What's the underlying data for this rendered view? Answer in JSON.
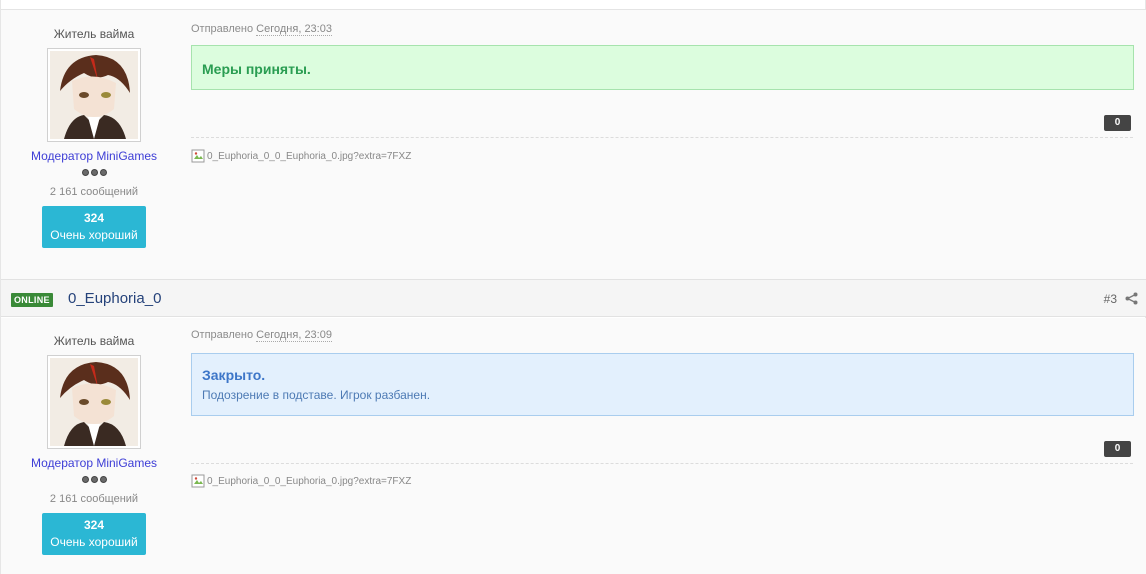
{
  "posts": [
    {
      "author_title": "Житель вайма",
      "group": "Модератор MiniGames",
      "post_count": "2 161 сообщений",
      "rep_value": "324",
      "rep_label": "Очень хороший",
      "posted_prefix": "Отправлено",
      "posted_date": "Сегодня, 23:03",
      "message_title": "Меры приняты.",
      "likes": "0",
      "signature_alt": "0_Euphoria_0_0_Euphoria_0.jpg?extra=7FXZ"
    },
    {
      "author_title": "Житель вайма",
      "group": "Модератор MiniGames",
      "post_count": "2 161 сообщений",
      "rep_value": "324",
      "rep_label": "Очень хороший",
      "posted_prefix": "Отправлено",
      "posted_date": "Сегодня, 23:09",
      "message_title": "Закрыто.",
      "message_body": "Подозрение в подставе. Игрок разбанен.",
      "likes": "0",
      "signature_alt": "0_Euphoria_0_0_Euphoria_0.jpg?extra=7FXZ"
    }
  ],
  "header": {
    "online_label": "ONLINE",
    "author": "0_Euphoria_0",
    "post_number": "#3"
  },
  "colors": {
    "rep_box": "#2bb7d4",
    "online_badge": "#3a8a38",
    "green_message": "#dcfdde",
    "blue_message": "#e3f0fd"
  },
  "icons": [
    "share-icon",
    "broken-image-icon"
  ]
}
